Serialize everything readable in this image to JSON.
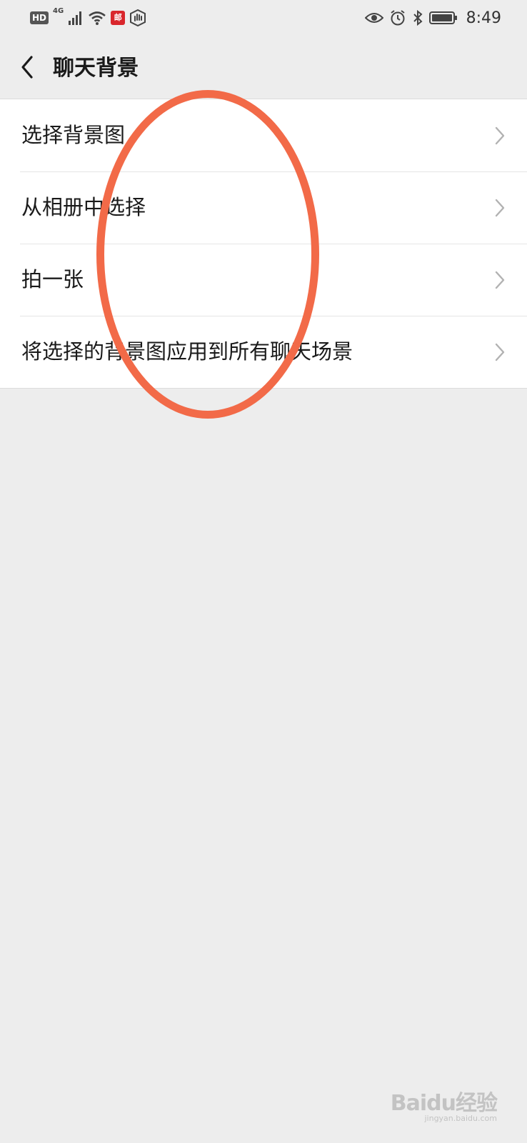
{
  "status_bar": {
    "hd_badge": "HD",
    "network": "4G",
    "app_badge": "邮",
    "time": "8:49",
    "icons_left": [
      "hd-icon",
      "signal-icon",
      "wifi-icon",
      "mail-app-icon",
      "hand-shield-icon"
    ],
    "icons_right": [
      "eye-icon",
      "alarm-icon",
      "bluetooth-icon",
      "battery-icon"
    ]
  },
  "nav": {
    "back_icon": "chevron-left-icon",
    "title": "聊天背景"
  },
  "menu": {
    "items": [
      {
        "label": "选择背景图"
      },
      {
        "label": "从相册中选择"
      },
      {
        "label": "拍一张"
      },
      {
        "label": "将选择的背景图应用到所有聊天场景"
      }
    ]
  },
  "annotation": {
    "color": "#f26a48"
  },
  "watermark": {
    "logo": "Baidu经验",
    "url": "jingyan.baidu.com"
  },
  "colors": {
    "background": "#ededed",
    "list_bg": "#ffffff",
    "text": "#1a1a1a",
    "chevron": "#b2b2b2"
  }
}
